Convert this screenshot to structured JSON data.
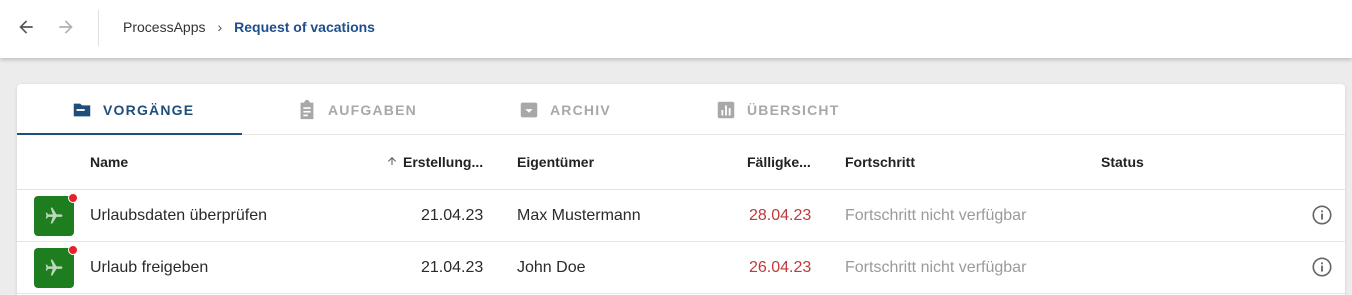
{
  "breadcrumb": {
    "root": "ProcessApps",
    "separator": "›",
    "current": "Request of vacations"
  },
  "icons": {
    "back": "arrow-left-icon",
    "forward": "arrow-right-icon",
    "row_avatar": "airplane-icon",
    "info": "info-icon"
  },
  "tabs": [
    {
      "label": "VORGÄNGE",
      "icon": "folder-icon",
      "active": true
    },
    {
      "label": "AUFGABEN",
      "icon": "clipboard-icon",
      "active": false
    },
    {
      "label": "ARCHIV",
      "icon": "archive-icon",
      "active": false
    },
    {
      "label": "ÜBERSICHT",
      "icon": "chart-icon",
      "active": false
    }
  ],
  "table": {
    "columns": {
      "name": "Name",
      "created": "Erstellung...",
      "owner": "Eigentümer",
      "due": "Fälligke...",
      "progress": "Fortschritt",
      "status": "Status"
    },
    "sort": {
      "column": "created",
      "direction": "ascending"
    },
    "rows": [
      {
        "name": "Urlaubsdaten überprüfen",
        "created": "21.04.23",
        "owner": "Max Mustermann",
        "due": "28.04.23",
        "progress": "Fortschritt nicht verfügbar",
        "status": ""
      },
      {
        "name": "Urlaub freigeben",
        "created": "21.04.23",
        "owner": "John Doe",
        "due": "26.04.23",
        "progress": "Fortschritt nicht verfügbar",
        "status": ""
      }
    ]
  },
  "colors": {
    "accent": "#1f4e7a",
    "avatar_bg": "#1e7d1e",
    "badge": "#e8202a",
    "overdue": "#c0393b"
  }
}
